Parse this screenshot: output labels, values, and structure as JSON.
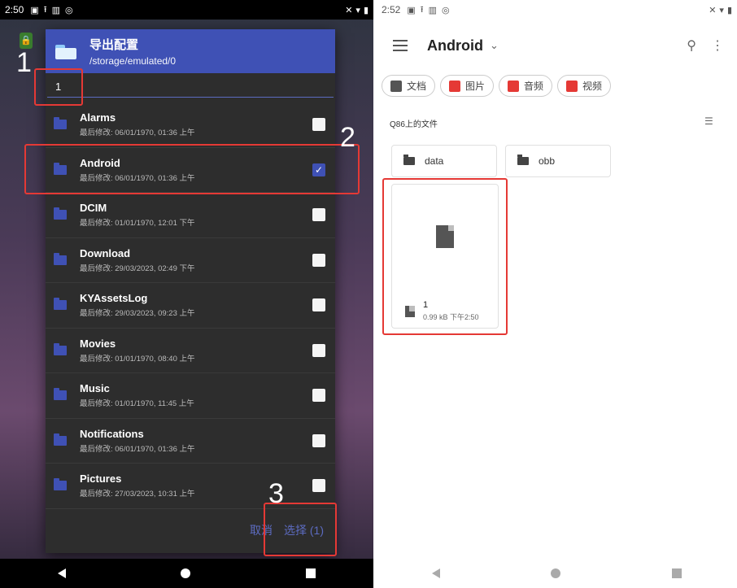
{
  "left": {
    "status": {
      "time": "2:50"
    },
    "dialog": {
      "title": "导出配置",
      "path": "/storage/emulated/0",
      "input_value": "1",
      "items": [
        {
          "name": "Alarms",
          "meta": "最后修改: 06/01/1970, 01:36 上午",
          "checked": false
        },
        {
          "name": "Android",
          "meta": "最后修改: 06/01/1970, 01:36 上午",
          "checked": true
        },
        {
          "name": "DCIM",
          "meta": "最后修改: 01/01/1970, 12:01 下午",
          "checked": false
        },
        {
          "name": "Download",
          "meta": "最后修改: 29/03/2023, 02:49 下午",
          "checked": false
        },
        {
          "name": "KYAssetsLog",
          "meta": "最后修改: 29/03/2023, 09:23 上午",
          "checked": false
        },
        {
          "name": "Movies",
          "meta": "最后修改: 01/01/1970, 08:40 上午",
          "checked": false
        },
        {
          "name": "Music",
          "meta": "最后修改: 01/01/1970, 11:45 上午",
          "checked": false
        },
        {
          "name": "Notifications",
          "meta": "最后修改: 06/01/1970, 01:36 上午",
          "checked": false
        },
        {
          "name": "Pictures",
          "meta": "最后修改: 27/03/2023, 10:31 上午",
          "checked": false
        }
      ],
      "cancel_label": "取消",
      "select_label": "选择 (1)"
    },
    "annotations": [
      "1",
      "2",
      "3"
    ]
  },
  "right": {
    "status": {
      "time": "2:52"
    },
    "title": "Android",
    "chips": [
      {
        "label": "文档",
        "color": "#555555"
      },
      {
        "label": "图片",
        "color": "#e53935"
      },
      {
        "label": "音频",
        "color": "#e53935"
      },
      {
        "label": "视频",
        "color": "#e53935"
      }
    ],
    "section_label": "Q86上的文件",
    "folders": [
      "data",
      "obb"
    ],
    "file": {
      "name": "1",
      "meta": "0.99 kB 下午2:50"
    }
  },
  "colors": {
    "accent": "#3f51b5",
    "highlight": "#e53935"
  }
}
